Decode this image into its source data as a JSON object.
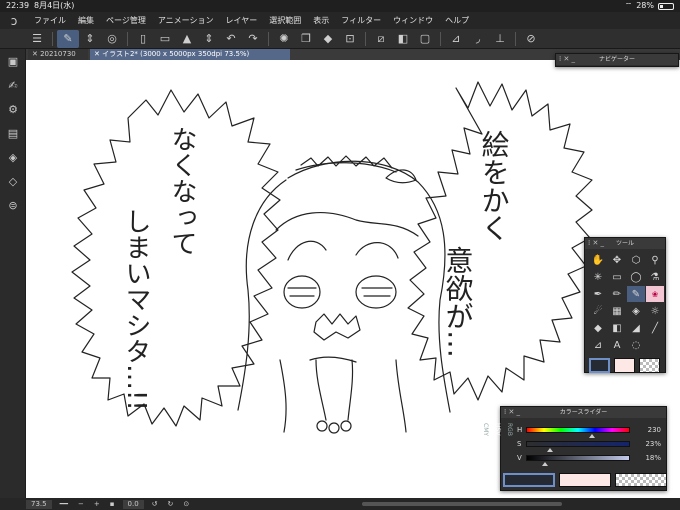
{
  "status": {
    "time": "22:39",
    "date": "8月4日(水)",
    "battery": "28%"
  },
  "menu": {
    "items": [
      "ファイル",
      "編集",
      "ページ管理",
      "アニメーション",
      "レイヤー",
      "選択範囲",
      "表示",
      "フィルター",
      "ウィンドウ",
      "ヘルプ"
    ]
  },
  "tabs": {
    "first": "20210730",
    "second": "イラスト2* (3000 x 5000px 350dpi 73.5%)"
  },
  "navigator": {
    "title": "ナビゲーター"
  },
  "tool_panel": {
    "title": "ツール"
  },
  "color_slider": {
    "title": "カラースライダー",
    "modes": [
      "RGB",
      "HSV",
      "CMY"
    ],
    "selected_mode": "HSV",
    "h_label": "H",
    "h_value": "230",
    "s_label": "S",
    "s_value": "23%",
    "v_label": "V",
    "v_value": "18%",
    "h": 230,
    "s": 0.23,
    "v": 0.18
  },
  "colors": {
    "main": "#252a33",
    "sub": "#fde8e5",
    "accent": "#4a5f80"
  },
  "canvas_text": {
    "left_line1": "なくなって",
    "left_line2": "しまいマシタ…!!",
    "right_line1": "絵をかく",
    "right_line2": "意欲が…"
  },
  "bottom": {
    "zoom": "73.5",
    "rotation": "0.0"
  }
}
